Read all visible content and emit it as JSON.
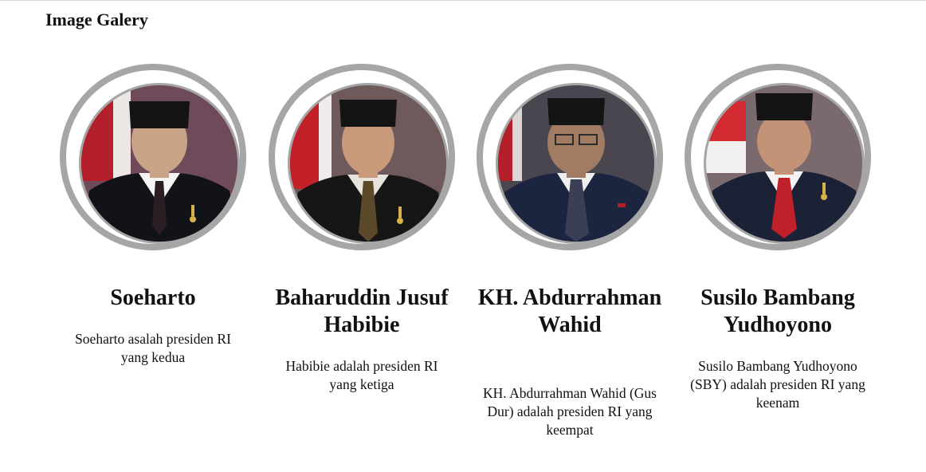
{
  "page": {
    "title": "Image Galery"
  },
  "gallery": [
    {
      "name": "Soeharto",
      "description": "Soeharto asalah presiden RI yang kedua",
      "image_alt": "Soeharto portrait",
      "colors": {
        "bg": "#6f4a5a",
        "suit": "#111318",
        "tie": "#2a1d24",
        "skin": "#c9a386"
      }
    },
    {
      "name": "Baharuddin Jusuf Habibie",
      "description": "Habibie adalah presiden RI yang ketiga",
      "image_alt": "Baharuddin Jusuf Habibie portrait",
      "colors": {
        "bg": "#6e5a5a",
        "suit": "#161616",
        "tie": "#5a4a2a",
        "skin": "#c89a7a"
      }
    },
    {
      "name": "KH. Abdurrahman Wahid",
      "description": "KH. Abdurrahman Wahid (Gus Dur) adalah presiden RI yang keempat",
      "image_alt": "KH. Abdurrahman Wahid portrait",
      "colors": {
        "bg": "#4a4650",
        "suit": "#1c2540",
        "tie": "#3a3f55",
        "skin": "#a27c62"
      }
    },
    {
      "name": "Susilo Bambang Yudhoyono",
      "description": "Susilo Bambang Yudhoyono (SBY) adalah presiden RI yang keenam",
      "image_alt": "Susilo Bambang Yudhoyono portrait",
      "colors": {
        "bg": "#7a6a6e",
        "suit": "#1b2236",
        "tie": "#c0202a",
        "skin": "#c49276"
      }
    }
  ]
}
